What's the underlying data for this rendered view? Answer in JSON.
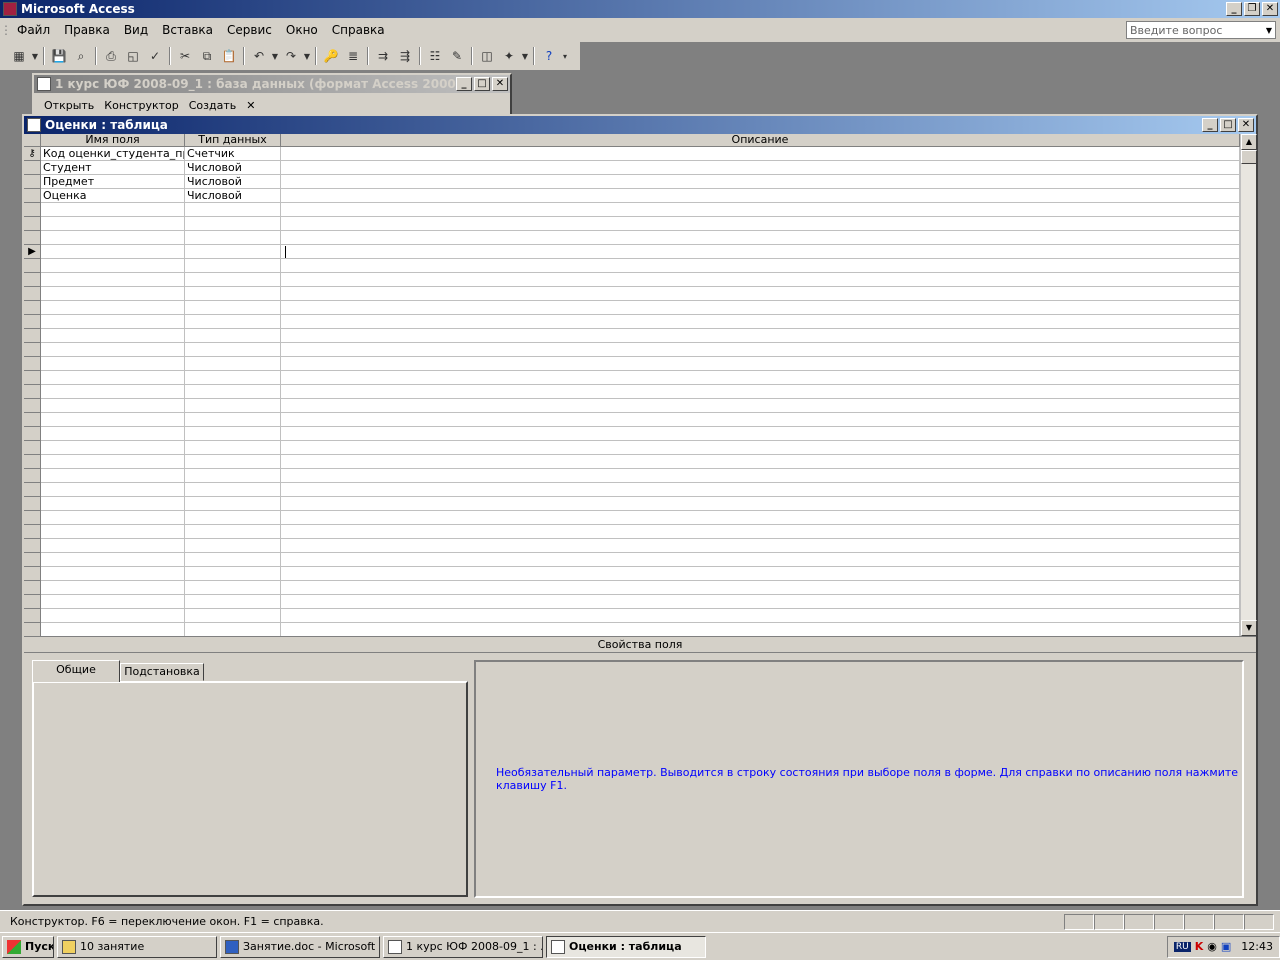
{
  "app": {
    "title": "Microsoft Access",
    "help_placeholder": "Введите вопрос"
  },
  "menu": [
    "Файл",
    "Правка",
    "Вид",
    "Вставка",
    "Сервис",
    "Окно",
    "Справка"
  ],
  "db_window": {
    "title": "1 курс ЮФ 2008-09_1 : база данных (формат Access 2000)",
    "toolbar": {
      "open": "Открыть",
      "design": "Конструктор",
      "create": "Создать"
    }
  },
  "table_window": {
    "title": "Оценки : таблица",
    "columns": [
      "Имя поля",
      "Тип данных",
      "Описание"
    ],
    "fields": [
      {
        "name": "Код оценки_студента_пре,",
        "type": "Счетчик",
        "primary_key": true
      },
      {
        "name": "Студент",
        "type": "Числовой"
      },
      {
        "name": "Предмет",
        "type": "Числовой"
      },
      {
        "name": "Оценка",
        "type": "Числовой"
      }
    ],
    "properties_label": "Свойства поля",
    "tabs": [
      "Общие",
      "Подстановка"
    ],
    "hint": "Необязательный параметр.  Выводится в строку состояния при выборе поля в форме.  Для справки по описанию поля нажмите клавишу F1."
  },
  "status": {
    "text": "Конструктор.  F6 = переключение окон.  F1 = справка."
  },
  "taskbar": {
    "start": "Пуск",
    "items": [
      "10 занятие",
      "Занятие.doc - Microsoft ...",
      "1 курс ЮФ 2008-09_1 : ...",
      "Оценки : таблица"
    ],
    "lang": "RU",
    "clock": "12:43"
  },
  "colors": {
    "title_active": "#0a246a",
    "hint_text": "#0000ff"
  }
}
